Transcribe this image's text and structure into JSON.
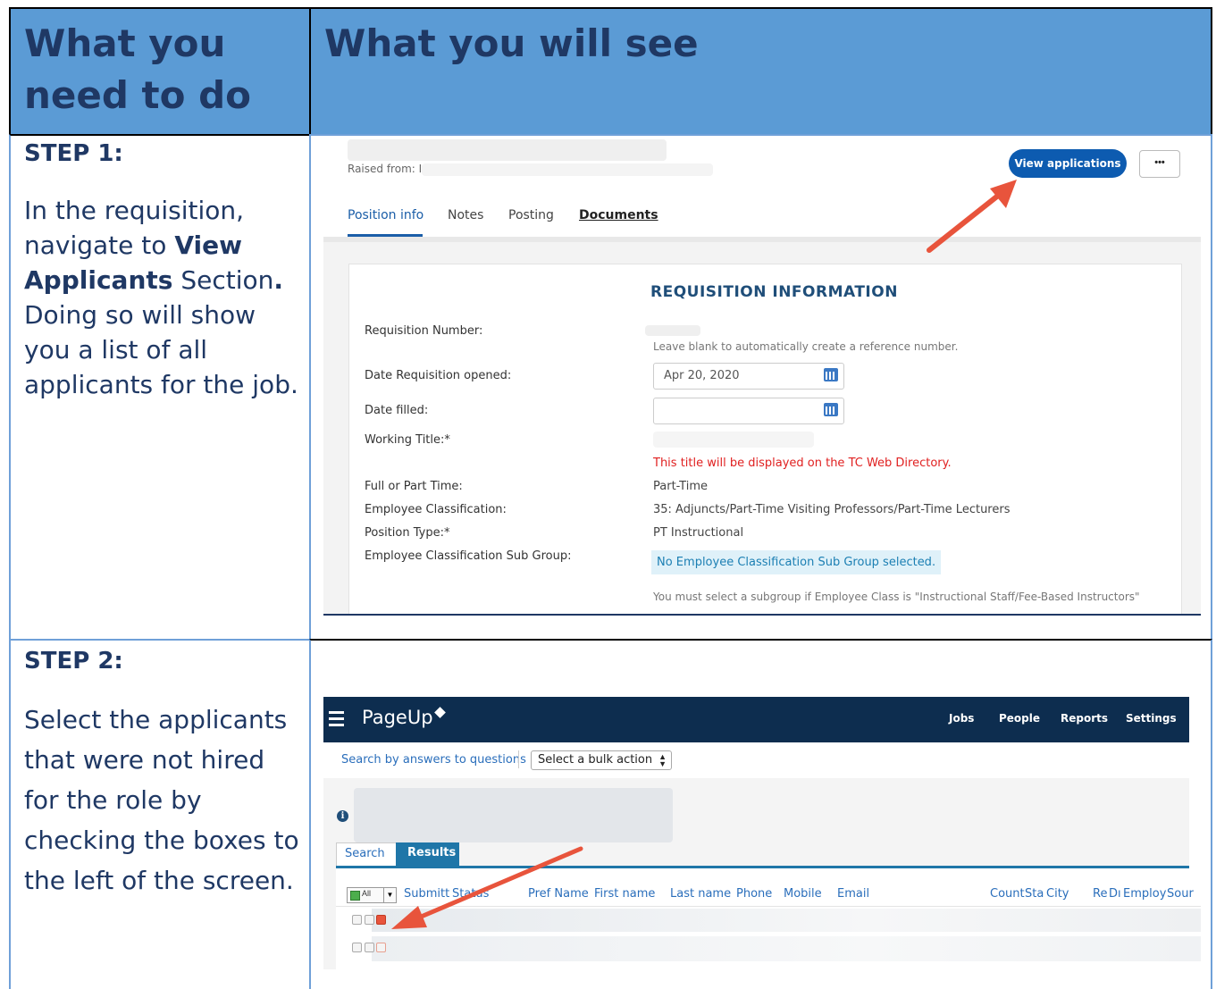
{
  "table": {
    "header_col1": "What you need to do",
    "header_col2": "What you will see"
  },
  "step1": {
    "title": "STEP 1:",
    "text_a": "In the requisition, navigate to ",
    "bold_a": "View Applicants",
    "text_b": " Section",
    "bold_b": ".",
    "text_c": " Doing so will show you a list of all applicants for the job."
  },
  "step2": {
    "title": "STEP 2:",
    "text": "Select the applicants that were not hired for the role by checking the boxes to the left of the screen."
  },
  "shot1": {
    "raised_from": "Raised from: I",
    "view_applications": "View applications",
    "more": "•••",
    "tabs": [
      "Position info",
      "Notes",
      "Posting",
      "Documents"
    ],
    "section_title": "REQUISITION INFORMATION",
    "fields": {
      "req_number_label": "Requisition Number:",
      "req_number_hint": "Leave blank to automatically create a reference number.",
      "date_opened_label": "Date Requisition opened:",
      "date_opened_value": "Apr 20, 2020",
      "date_filled_label": "Date filled:",
      "working_title_label": "Working Title:*",
      "working_title_hint": "This title will be displayed on the TC Web Directory.",
      "full_part_label": "Full or Part Time:",
      "full_part_value": "Part-Time",
      "emp_class_label": "Employee Classification:",
      "emp_class_value": "35: Adjuncts/Part-Time Visiting Professors/Part-Time Lecturers",
      "pos_type_label": "Position Type:*",
      "pos_type_value": "PT Instructional",
      "sub_group_label": "Employee Classification Sub Group:",
      "sub_group_value": "No Employee Classification Sub Group selected.",
      "sub_group_hint": "You must select a subgroup if Employee Class is \"Instructional Staff/Fee-Based Instructors\""
    }
  },
  "shot2": {
    "brand": "PageUp",
    "nav": [
      "Jobs",
      "People",
      "Reports",
      "Settings"
    ],
    "search_link": "Search by answers to questions",
    "bulk_action": "Select a bulk action",
    "tabs": [
      "Search",
      "Results"
    ],
    "all_label": "All",
    "columns": [
      "Submitt",
      "Status",
      "Pref Name",
      "First name",
      "Last name",
      "Phone",
      "Mobile",
      "Email",
      "Count",
      "Sta",
      "City",
      "Re",
      "Dı",
      "Employ",
      "Sour"
    ]
  },
  "colors": {
    "header_bg": "#5b9bd5",
    "text_dark_blue": "#1f3864",
    "button_blue": "#0d5bb0",
    "nav_bar": "#0d2d4f",
    "error_red": "#e02020",
    "arrow": "#e8543c"
  }
}
